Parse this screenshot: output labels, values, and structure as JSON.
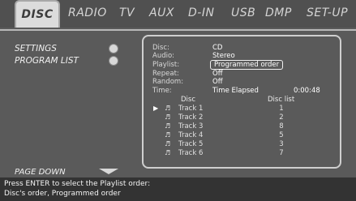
{
  "tabs": [
    "DISC",
    "RADIO",
    "TV",
    "AUX",
    "D-IN",
    "USB",
    "DMP",
    "SET-UP"
  ],
  "menu": {
    "settings": "SETTINGS",
    "program_list": "PROGRAM LIST",
    "page_down": "PAGE DOWN"
  },
  "info": {
    "disc_label": "Disc:",
    "disc_value": "CD",
    "audio_label": "Audio:",
    "audio_value": "Stereo",
    "playlist_label": "Playlist:",
    "playlist_value": "Programmed order",
    "repeat_label": "Repeat:",
    "repeat_value": "Off",
    "random_label": "Random:",
    "random_value": "Off",
    "time_label": "Time:",
    "time_mode": "Time Elapsed",
    "time_value": "0:00:48"
  },
  "tracklist": {
    "col_disc": "Disc",
    "col_disc_list": "Disc list",
    "rows": [
      {
        "name": "Track 1",
        "num": "1"
      },
      {
        "name": "Track 2",
        "num": "2"
      },
      {
        "name": "Track 3",
        "num": "8"
      },
      {
        "name": "Track 4",
        "num": "5"
      },
      {
        "name": "Track 5",
        "num": "3"
      },
      {
        "name": "Track 6",
        "num": "7"
      }
    ]
  },
  "help": {
    "line1": "Press ENTER to select the Playlist order:",
    "line2": "Disc's order, Programmed order"
  },
  "icons": {
    "play": "play-icon",
    "note": "music-note-icon"
  }
}
